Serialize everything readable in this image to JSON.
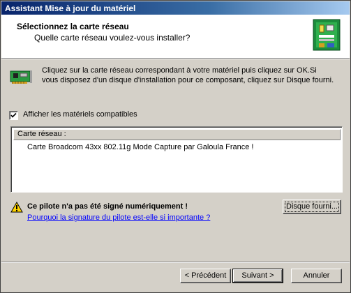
{
  "window": {
    "title": "Assistant Mise à jour du matériel"
  },
  "header": {
    "title": "Sélectionnez la carte réseau",
    "subtitle": "Quelle carte réseau voulez-vous installer?"
  },
  "intro": {
    "text": "Cliquez sur la carte réseau correspondant à votre matériel puis cliquez sur OK.Si vous disposez d'un disque d'installation pour ce composant, cliquez sur Disque fourni."
  },
  "compatible": {
    "label": "Afficher les matériels compatibles",
    "checked": true
  },
  "list": {
    "header": "Carte réseau :",
    "items": [
      "Carte Broadcom 43xx 802.11g Mode Capture par Galoula France !"
    ]
  },
  "warning": {
    "title": "Ce pilote n'a pas été signé numériquement !",
    "link": "Pourquoi la signature du pilote est-elle si importante ?"
  },
  "buttons": {
    "have_disk": "Disque fourni...",
    "back": "< Précédent",
    "next": "Suivant >",
    "cancel": "Annuler"
  },
  "colors": {
    "title_bar_start": "#08246b",
    "title_bar_end": "#a6caf0",
    "face": "#d4d0c8",
    "link": "#0000ff"
  },
  "icons": {
    "header": "hardware-wizard-icon",
    "network_card": "network-card-icon",
    "warning": "warning-icon",
    "check": "checkmark-icon"
  }
}
